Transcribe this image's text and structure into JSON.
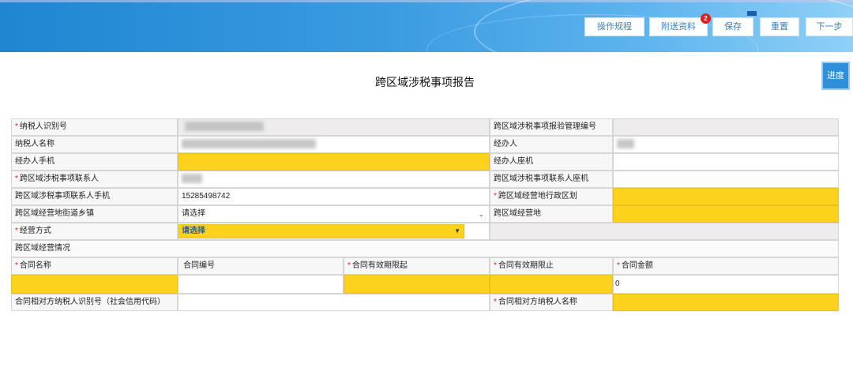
{
  "toolbar": {
    "rules_label": "操作规程",
    "attach_label": "附送资料",
    "attach_badge": "2",
    "save_label": "保存",
    "reset_label": "重置",
    "next_label": "下一步"
  },
  "page": {
    "title": "跨区域涉税事项报告",
    "progress_label": "进度"
  },
  "form": {
    "taxpayer_id_label": "纳税人识别号",
    "report_mgmt_no_label": "跨区域涉税事项报验管理编号",
    "taxpayer_name_label": "纳税人名称",
    "handler_label": "经办人",
    "handler_mobile_label": "经办人手机",
    "handler_phone_label": "经办人座机",
    "contact_label": "跨区域涉税事项联系人",
    "contact_phone_label": "跨区域涉税事项联系人座机",
    "contact_mobile_label": "跨区域涉税事项联系人手机",
    "contact_mobile_value": "15285498742",
    "region_label": "跨区域经营地行政区划",
    "street_label": "跨区域经营地街道乡镇",
    "street_value": "请选择",
    "address_label": "跨区域经营地",
    "mode_label": "经营方式",
    "mode_value": "请选择",
    "section_label": "跨区域经营情况",
    "contract_name_label": "合同名称",
    "contract_no_label": "合同编号",
    "valid_from_label": "合同有效期限起",
    "valid_to_label": "合同有效期限止",
    "amount_label": "合同金额",
    "amount_value": "0",
    "counterparty_id_label": "合同相对方纳税人识别号（社会信用代码）",
    "counterparty_name_label": "合同相对方纳税人名称",
    "required_mark": "*"
  },
  "colors": {
    "required": "#e02020",
    "highlight": "#fcd21c",
    "header": "#2f8fd8"
  }
}
